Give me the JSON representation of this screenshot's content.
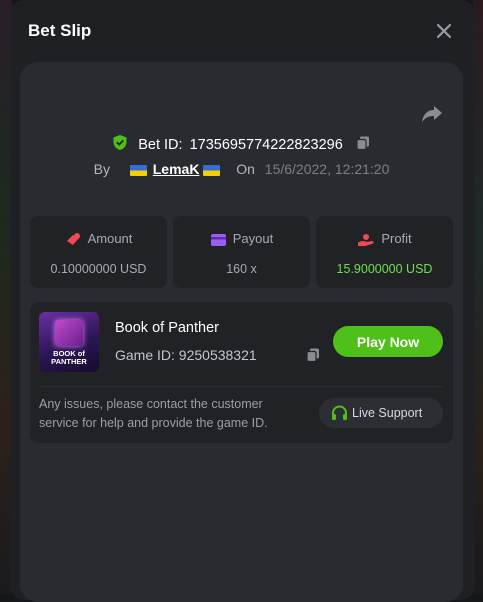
{
  "modal": {
    "title": "Bet Slip"
  },
  "bet": {
    "id_label": "Bet ID:",
    "id": "1735695774222823296",
    "by_label": "By",
    "username": "LemaK",
    "on_label": "On",
    "timestamp": "15/6/2022, 12:21:20"
  },
  "stats": [
    {
      "label": "Amount",
      "value": "0.10000000 USD",
      "icon": "amount-icon"
    },
    {
      "label": "Payout",
      "value": "160 x",
      "icon": "payout-icon"
    },
    {
      "label": "Profit",
      "value": "15.9000000 USD",
      "icon": "profit-icon",
      "value_color": "#6ce14e"
    }
  ],
  "game": {
    "name": "Book of Panther",
    "id_text": "Game ID: 9250538321",
    "thumb_text": "BOOK of PANTHER",
    "play_label": "Play Now",
    "notice": "Any issues, please contact the customer service for help and provide the game ID.",
    "support_label": "Live Support"
  },
  "colors": {
    "accent": "#4fc019",
    "profit": "#6ce14e",
    "background": "#1f2024",
    "panel": "#2a2b31"
  }
}
